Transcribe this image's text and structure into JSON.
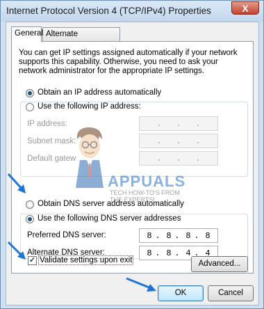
{
  "window": {
    "title": "Internet Protocol Version 4 (TCP/IPv4) Properties",
    "close_glyph": "X"
  },
  "tabs": [
    {
      "label": "General",
      "active": true
    },
    {
      "label": "Alternate Configuration",
      "active": false
    }
  ],
  "description": "You can get IP settings assigned automatically if your network supports this capability. Otherwise, you need to ask your network administrator for the appropriate IP settings.",
  "ip_section": {
    "auto_label": "Obtain an IP address automatically",
    "manual_label": "Use the following IP address:",
    "auto_selected": true,
    "fields": [
      {
        "label": "IP address:",
        "value": [
          ".",
          ".",
          "."
        ]
      },
      {
        "label": "Subnet mask:",
        "value": [
          ".",
          ".",
          "."
        ]
      },
      {
        "label": "Default gatew",
        "value": [
          ".",
          ".",
          "."
        ]
      }
    ]
  },
  "dns_section": {
    "auto_label": "Obtain DNS server address automatically",
    "manual_label": "Use the following DNS server addresses",
    "manual_selected": true,
    "preferred": {
      "label": "Preferred DNS server:",
      "octets": [
        "8",
        "8",
        "8",
        "8"
      ]
    },
    "alternate": {
      "label": "Alternate DNS server:",
      "octets": [
        "8",
        "8",
        "4",
        "4"
      ]
    }
  },
  "validate": {
    "label": "Validate settings upon exit",
    "checked": true
  },
  "buttons": {
    "advanced": "Advanced...",
    "ok": "OK",
    "cancel": "Cancel"
  },
  "watermark": {
    "brand": "APPUALS",
    "tagline_1": "TECH HOW-TO'S FROM",
    "tagline_2": "THE EXPERTS!"
  },
  "colors": {
    "accent": "#1e73d8",
    "title_bar": "#c3d7ec"
  }
}
